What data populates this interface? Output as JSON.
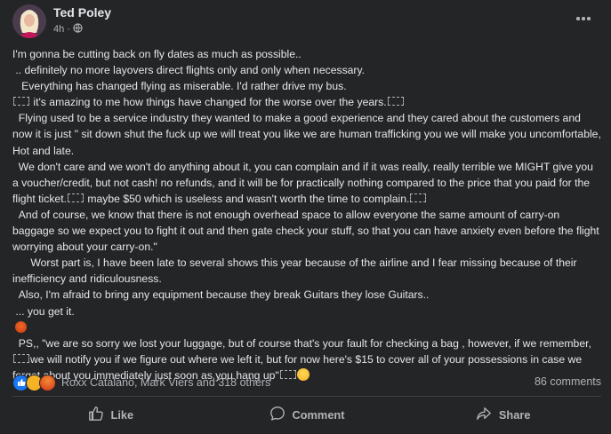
{
  "post": {
    "author": "Ted Poley",
    "time": "4h",
    "audience_icon": "globe-icon",
    "more_icon": "more-options-icon"
  },
  "body": {
    "line1": "I'm gonna be cutting back on fly dates as much as possible..",
    "line2": " .. definitely no more layovers direct flights only and only when necessary.",
    "line3": "   Everything has changed flying as miserable. I'd rather drive my bus.",
    "line4": " it's amazing to me how things have changed for the worse over the years.",
    "line5": "  Flying used to be a service industry they wanted to make a good experience and they cared about the customers and now it is just \" sit down shut the fuck up we will treat you like we are human trafficking you we will make you uncomfortable, Hot and late.",
    "line6a": "  We don't care and we won't do anything about it, you can complain and if it was really, really terrible we MIGHT give you a voucher/credit, but not cash! no refunds, and it will be for practically nothing compared to the price that you paid for the flight ticket.",
    "line6b": " maybe $50 which is useless and wasn't worth the time to complain.",
    "line7": "  And of course, we know that there is not enough overhead space to allow everyone the same amount of carry-on baggage so we expect you to fight it out and then gate check your stuff, so that you can have anxiety even before the flight worrying about your carry-on.\"",
    "line8": "      Worst part is, I have been late to several shows this year because of the airline and I fear missing because of their inefficiency and ridiculousness.",
    "line9": "  Also, I'm afraid to bring any equipment because they break Guitars they lose Guitars..",
    "line10": " ... you get it.",
    "line11a": "  PS,, \"we are so sorry we lost your luggage, but of course that's your fault for checking a bag , however, if we remember, ",
    "line11b": "we will notify you if we figure out where we left it, but for now here's $15 to cover all of your possessions in case we forget about you immediately just soon as you hang up\""
  },
  "reactions": {
    "names": "Roxx Catalano, Mark Viers and 318 others",
    "comments": "86 comments",
    "icons": [
      "like-reaction-icon",
      "care-reaction-icon",
      "angry-reaction-icon"
    ]
  },
  "actions": {
    "like": "Like",
    "comment": "Comment",
    "share": "Share"
  },
  "colors": {
    "background": "#242526",
    "text": "#e4e6eb",
    "secondary_text": "#b0b3b8",
    "like_blue": "#1877f2"
  }
}
